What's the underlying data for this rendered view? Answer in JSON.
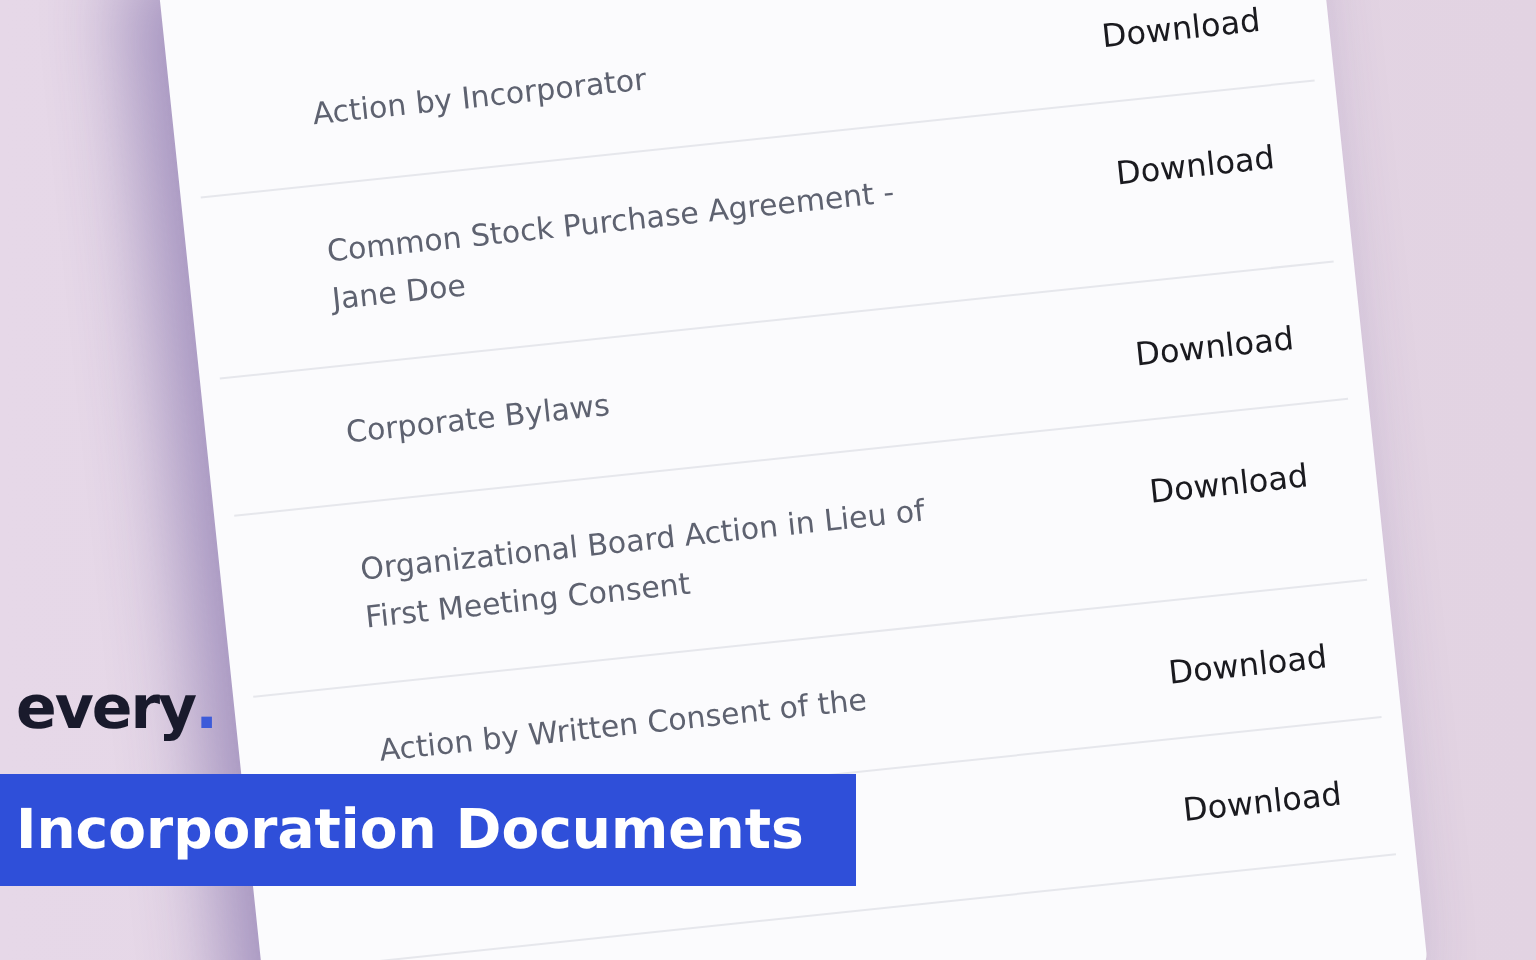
{
  "brand": {
    "name": "every",
    "dot": "."
  },
  "banner": {
    "title": "Incorporation Documents"
  },
  "documents": [
    {
      "title": "Action by Incorporator",
      "action": "Download"
    },
    {
      "title": "Common Stock Purchase Agreement - Jane Doe",
      "action": "Download"
    },
    {
      "title": "Corporate Bylaws",
      "action": "Download"
    },
    {
      "title": "Organizational Board Action in Lieu of First Meeting Consent",
      "action": "Download"
    },
    {
      "title": "Action by Written Consent of the",
      "action": "Download"
    },
    {
      "action": "Download"
    }
  ]
}
